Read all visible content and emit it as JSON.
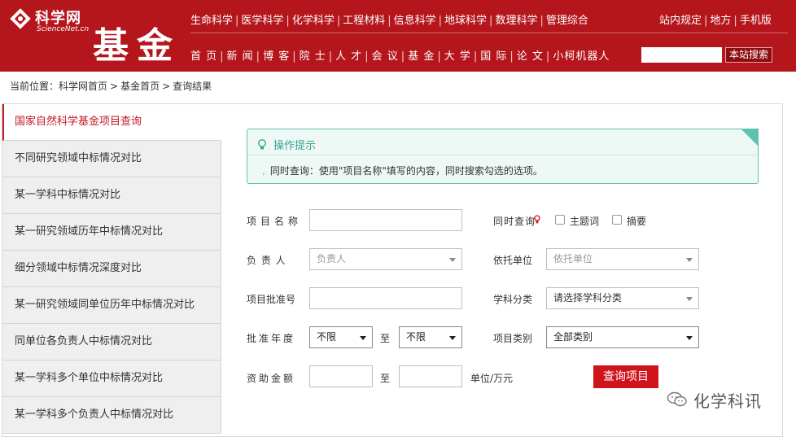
{
  "header": {
    "logo_cn": "科学网",
    "logo_en": "ScienceNet.cn",
    "section_title": "基金",
    "top_nav": [
      "生命科学",
      "医学科学",
      "化学科学",
      "工程材料",
      "信息科学",
      "地球科学",
      "数理科学",
      "管理综合"
    ],
    "right_links": [
      "站内规定",
      "地方",
      "手机版"
    ],
    "main_nav": [
      "首 页",
      "新 闻",
      "博 客",
      "院 士",
      "人 才",
      "会 议",
      "基 金",
      "大 学",
      "国 际",
      "论 文",
      "小柯机器人"
    ],
    "search_button": "本站搜索"
  },
  "breadcrumb": {
    "prefix": "当前位置：",
    "items": [
      "科学网首页",
      "基金首页",
      "查询结果"
    ],
    "separator": ">"
  },
  "sidebar": {
    "items": [
      "国家自然科学基金项目查询",
      "不同研究领域中标情况对比",
      "某一学科中标情况对比",
      "某一研究领域历年中标情况对比",
      "细分领域中标情况深度对比",
      "某一研究领域同单位历年中标情况对比",
      "同单位各负责人中标情况对比",
      "某一学科多个单位中标情况对比",
      "某一学科多个负责人中标情况对比"
    ],
    "active_index": 0
  },
  "tip": {
    "title": "操作提示",
    "text": "同时查询：使用\"项目名称\"填写的内容，同时搜索勾选的选项。"
  },
  "form": {
    "project_name_label": "项目名称",
    "simultaneous_label": "同时查询",
    "checkbox_topic": "主题词",
    "checkbox_abstract": "摘要",
    "leader_label": "负 责 人",
    "leader_placeholder": "负责人",
    "institution_label": "依托单位",
    "institution_placeholder": "依托单位",
    "approval_no_label": "项目批准号",
    "discipline_label": "学科分类",
    "discipline_value": "请选择学科分类",
    "year_label": "批准年度",
    "year_from": "不限",
    "to_label": "至",
    "year_to": "不限",
    "category_label": "项目类别",
    "category_value": "全部类别",
    "amount_label": "资助金额",
    "amount_unit": "单位/万元",
    "query_button": "查询项目"
  },
  "watermark": "化学科讯",
  "colors": {
    "brand_red": "#b4161c",
    "button_red": "#d0141c",
    "tip_green": "#5fc1af"
  }
}
